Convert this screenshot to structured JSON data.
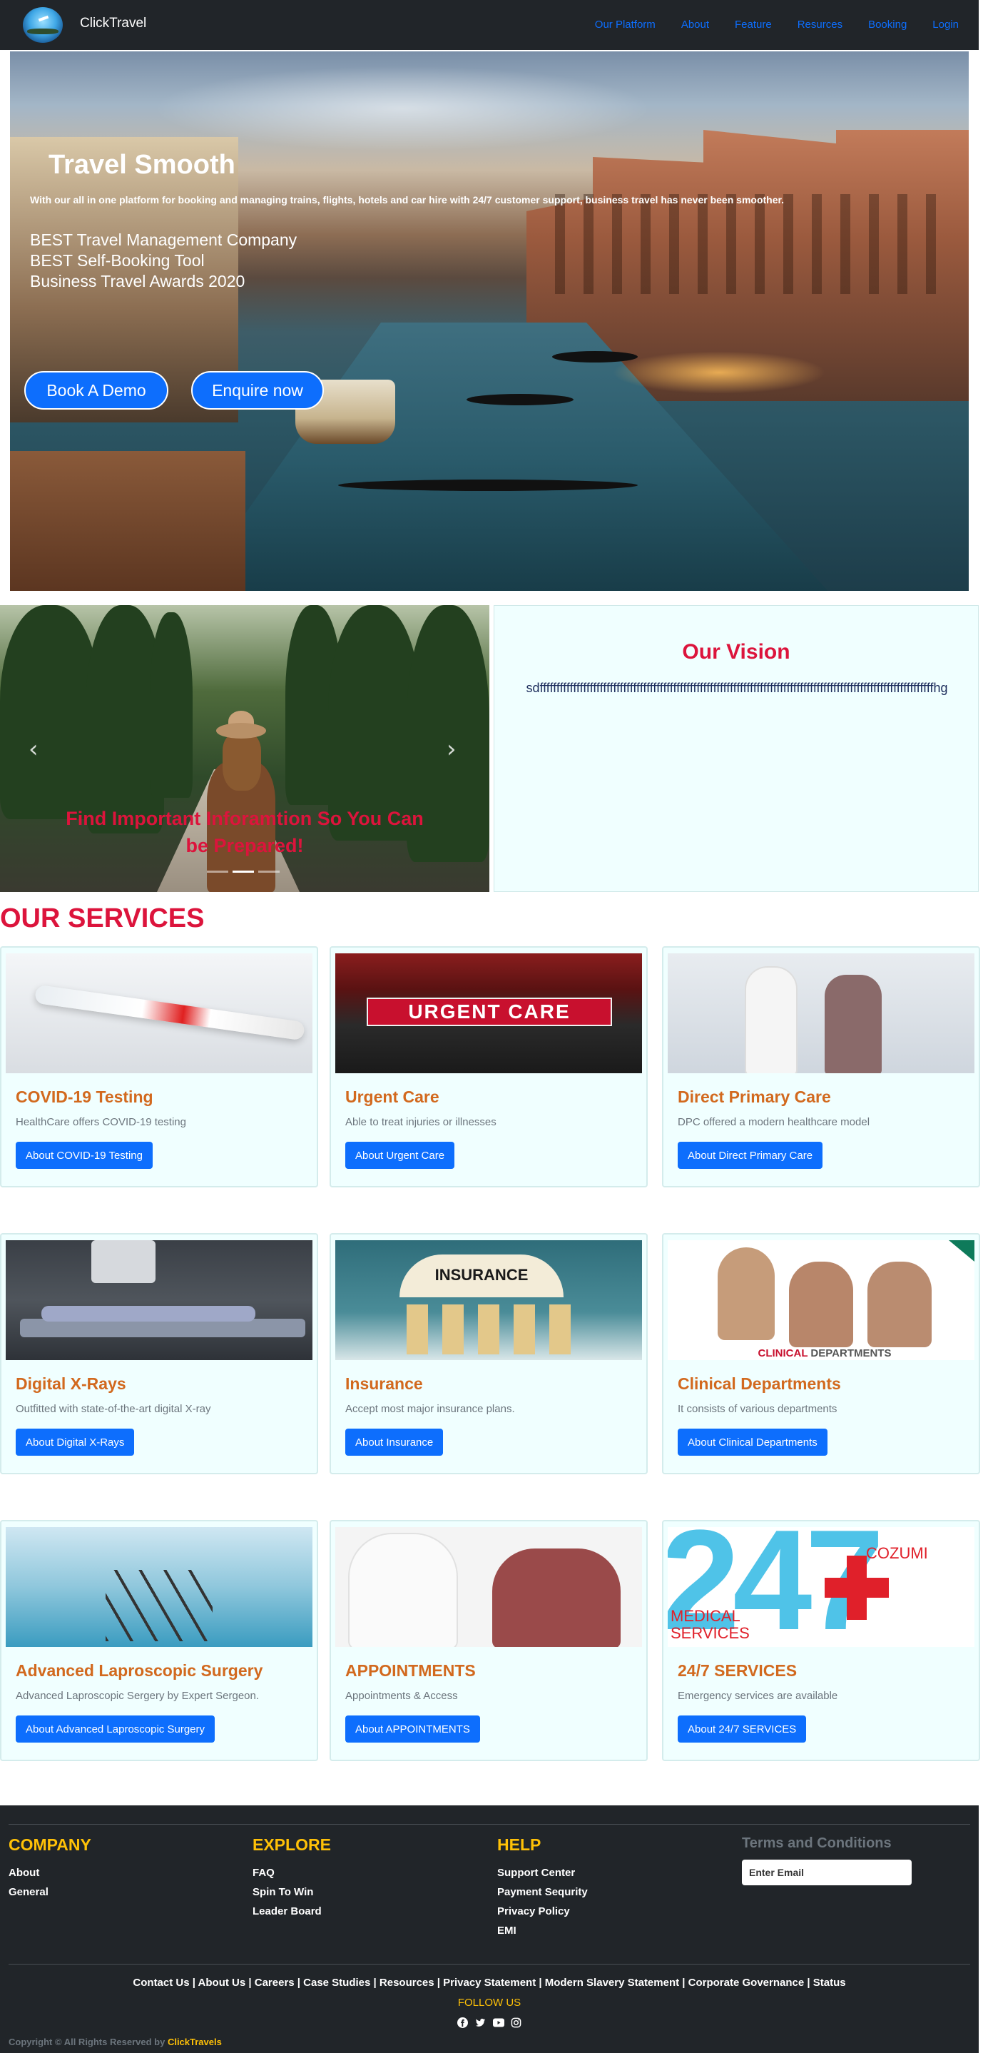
{
  "nav": {
    "brand": "ClickTravel",
    "links": [
      "Our Platform",
      "About",
      "Feature",
      "Resurces",
      "Booking",
      "Login"
    ]
  },
  "hero": {
    "title": "Travel Smooth",
    "subtitle": "With our all in one platform for booking and managing trains, flights, hotels and car hire with 24/7 customer support, business travel has never been smoother.",
    "awards": [
      "BEST Travel Management Company",
      "BEST Self-Booking Tool",
      "Business Travel Awards 2020"
    ],
    "btn_demo": "Book A Demo",
    "btn_enquire": "Enquire now"
  },
  "carousel": {
    "caption": "Find Important Inforamtion So You Can be Prepared!",
    "prev_icon": "‹",
    "next_icon": "›",
    "active_slide": 2,
    "slide_count": 3
  },
  "vision": {
    "title": "Our Vision",
    "text": "sdffffffffffffffffffffffffffffffffffffffffffffffffffffffffffffffffffffffffffffffffffffffffffffffffffffffffffffffffffffffhg"
  },
  "services": {
    "title": "OUR SERVICES",
    "cards": [
      {
        "title": "COVID-19 Testing",
        "text": "HealthCare offers COVID-19 testing",
        "button": "About COVID-19 Testing"
      },
      {
        "title": "Urgent Care",
        "text": "Able to treat injuries or illnesses",
        "button": "About Urgent Care",
        "img_text": "URGENT CARE"
      },
      {
        "title": "Direct Primary Care",
        "text": "DPC offered a modern healthcare model",
        "button": "About Direct Primary Care"
      },
      {
        "title": "Digital X-Rays",
        "text": "Outfitted with state-of-the-art digital X-ray",
        "button": "About Digital X-Rays"
      },
      {
        "title": "Insurance",
        "text": "Accept most major insurance plans.",
        "button": "About Insurance",
        "img_text": "INSURANCE"
      },
      {
        "title": "Clinical Departments",
        "text": "It consists of various departments",
        "button": "About Clinical Departments",
        "img_text_red": "CLINICAL",
        "img_text_gray": "DEPARTMENTS"
      },
      {
        "title": "Advanced Laproscopic Surgery",
        "text": "Advanced Laproscopic Sergery by Expert Sergeon.",
        "button": "About Advanced Laproscopic Surgery"
      },
      {
        "title": "APPOINTMENTS",
        "text": "Appointments & Access",
        "button": "About APPOINTMENTS"
      },
      {
        "title": "24/7 SERVICES",
        "text": "Emergency services are available",
        "button": "About 24/7 SERVICES",
        "img_num": "247",
        "img_word1": "COZUMI",
        "img_word2": "MEDICAL",
        "img_word3": "SERVICES"
      }
    ]
  },
  "footer": {
    "company": {
      "heading": "COMPANY",
      "links": [
        "About",
        "General"
      ]
    },
    "explore": {
      "heading": "EXPLORE",
      "links": [
        "FAQ",
        "Spin To Win",
        "Leader Board"
      ]
    },
    "help": {
      "heading": "HELP",
      "links": [
        "Support Center",
        "Payment Sequrity",
        "Privacy Policy",
        "EMI"
      ]
    },
    "terms": "Terms and Conditions",
    "email_placeholder": "Enter Email",
    "bottom_links": "Contact Us | About Us | Careers | Case Studies | Resources | Privacy Statement | Modern Slavery Statement | Corporate Governance | Status",
    "follow": "FOLLOW US",
    "copyright_prefix": "Copyright © All Rights Reserved by",
    "copyright_brand": "ClickTravels"
  },
  "colors": {
    "accent": "#0d6efd",
    "crimson": "#dc143c",
    "card_title": "#d2691e",
    "footer_heading": "#ffc107",
    "footer_bg": "#212529",
    "card_bg": "#f0ffff"
  }
}
